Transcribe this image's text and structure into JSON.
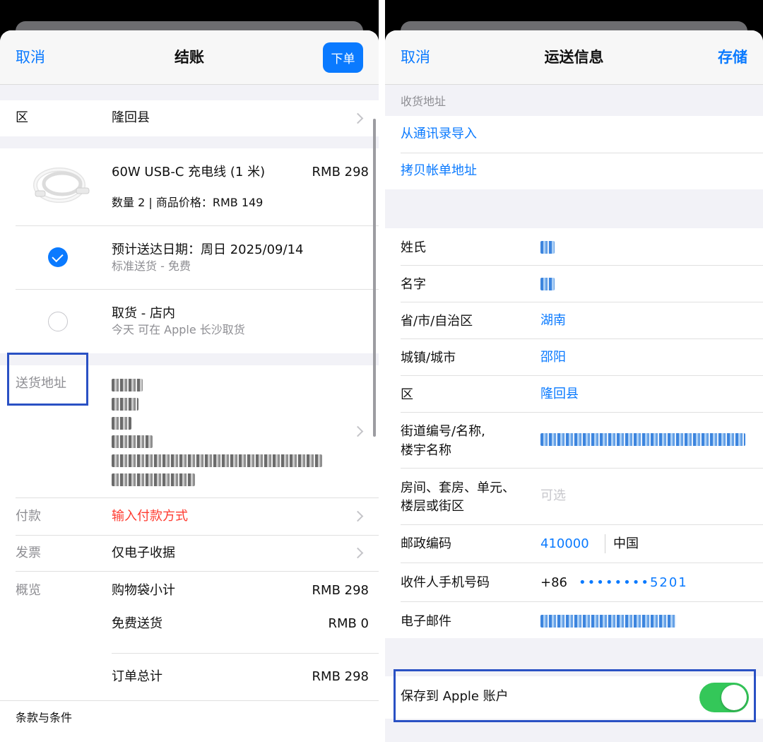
{
  "checkout": {
    "cancel": "取消",
    "title": "结账",
    "order_button": "下单",
    "district_label": "区",
    "district_value": "隆回县",
    "product_name": "60W USB-C 充电线 (1 米)",
    "product_price": "RMB 298",
    "product_detail": "数量 2 | 商品价格：RMB 149",
    "delivery_date": "预计送达日期：周日 2025/09/14",
    "delivery_type": "标准送货 - 免费",
    "pickup_title": "取货 - 店内",
    "pickup_detail": "今天 可在 Apple 长沙取货",
    "shipping_label": "送货地址",
    "payment_label": "付款",
    "payment_value": "输入付款方式",
    "invoice_label": "发票",
    "invoice_value": "仅电子收据",
    "summary_label": "概览",
    "subtotal_label": "购物袋小计",
    "subtotal_value": "RMB 298",
    "shipping_fee_label": "免费送货",
    "shipping_fee_value": "RMB 0",
    "total_label": "订单总计",
    "total_value": "RMB 298",
    "terms": "条款与条件"
  },
  "shipping": {
    "cancel": "取消",
    "title": "运送信息",
    "save": "存储",
    "section_header": "收货地址",
    "import_contacts": "从通讯录导入",
    "copy_billing": "拷贝帐单地址",
    "last_name_label": "姓氏",
    "first_name_label": "名字",
    "province_label": "省/市/自治区",
    "province_value": "湖南",
    "city_label": "城镇/城市",
    "city_value": "邵阳",
    "district_label": "区",
    "district_value": "隆回县",
    "street_label_1": "街道编号/名称,",
    "street_label_2": "楼宇名称",
    "room_label_1": "房间、套房、单元、",
    "room_label_2": "楼层或街区",
    "room_placeholder": "可选",
    "postcode_label": "邮政编码",
    "postcode_value": "410000",
    "country_value": "中国",
    "phone_label": "收件人手机号码",
    "phone_prefix": "+86",
    "phone_value": "••••••••5201",
    "email_label": "电子邮件",
    "save_to_account": "保存到 Apple 账户",
    "save_toggle_on": true
  },
  "colors": {
    "accent": "#0a7aff",
    "error": "#ff3b30",
    "toggle": "#34c759",
    "highlight": "#2a51c4"
  }
}
